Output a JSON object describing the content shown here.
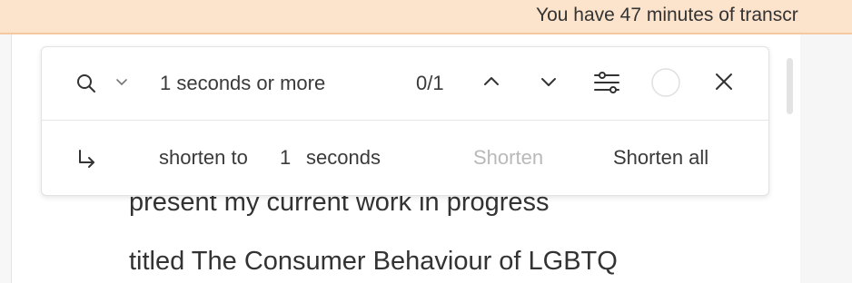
{
  "banner": {
    "text": "You have 47 minutes of transcr"
  },
  "search": {
    "query": "1 seconds or more",
    "counter": "0/1"
  },
  "shorten": {
    "label_prefix": "shorten to",
    "value": "1",
    "label_suffix": "seconds",
    "shorten_button": "Shorten",
    "shorten_all_button": "Shorten all"
  },
  "transcript": {
    "lines": [
      "present my current work in progress",
      "titled The Consumer Behaviour of LGBTQ"
    ]
  },
  "icons": {
    "search": "search-icon",
    "dropdown": "chevron-down-icon",
    "prev": "chevron-up-icon",
    "next": "chevron-down-icon",
    "filters": "sliders-icon",
    "circle": "circle-toggle-icon",
    "close": "close-icon",
    "return": "return-arrow-icon"
  },
  "colors": {
    "banner_bg": "#fce3cc",
    "disabled_text": "#b9b9b9"
  }
}
